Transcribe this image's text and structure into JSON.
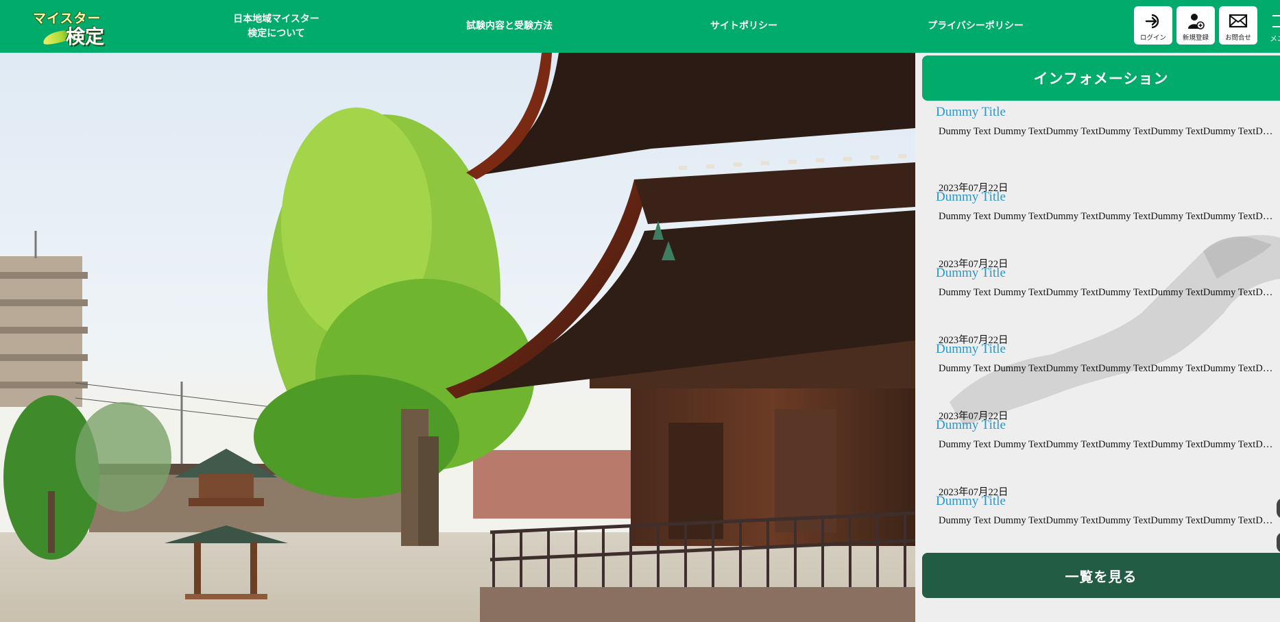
{
  "brand": {
    "logo_top": "マイスター",
    "logo_bottom": "検定"
  },
  "nav": [
    {
      "label": "日本地域マイスター\n検定について"
    },
    {
      "label": "試験内容と受験方法"
    },
    {
      "label": "サイトポリシー"
    },
    {
      "label": "プライバシーポリシー"
    }
  ],
  "header_buttons": {
    "login": {
      "label": "ログイン",
      "icon": "login-icon"
    },
    "register": {
      "label": "新規登録",
      "icon": "user-plus-icon"
    },
    "contact": {
      "label": "お問合せ",
      "icon": "mail-icon"
    },
    "menu_partial": "メニ"
  },
  "info": {
    "heading": "インフォメーション",
    "items": [
      {
        "date": "",
        "title": "Dummy Title",
        "text": "Dummy Text Dummy TextDummy TextDummy TextDummy TextDummy TextDummy Text"
      },
      {
        "date": "2023年07月22日",
        "title": "Dummy Title",
        "text": "Dummy Text Dummy TextDummy TextDummy TextDummy TextDummy TextDummy Text"
      },
      {
        "date": "2023年07月22日",
        "title": "Dummy Title",
        "text": "Dummy Text Dummy TextDummy TextDummy TextDummy TextDummy TextDummy Text"
      },
      {
        "date": "2023年07月22日",
        "title": "Dummy Title",
        "text": "Dummy Text Dummy TextDummy TextDummy TextDummy TextDummy TextDummy Text"
      },
      {
        "date": "2023年07月22日",
        "title": "Dummy Title",
        "text": "Dummy Text Dummy TextDummy TextDummy TextDummy TextDummy TextDummy Text"
      },
      {
        "date": "2023年07月22日",
        "title": "Dummy Title",
        "text": "Dummy Text Dummy TextDummy TextDummy TextDummy TextDummy TextDummy Text"
      }
    ],
    "view_all": "一覧を見る"
  },
  "colors": {
    "header": "#00ab6b",
    "info_header": "#00ab6b",
    "view_all": "#225c44",
    "title_link": "#2997c9",
    "panel_bg": "#eeeeee"
  }
}
